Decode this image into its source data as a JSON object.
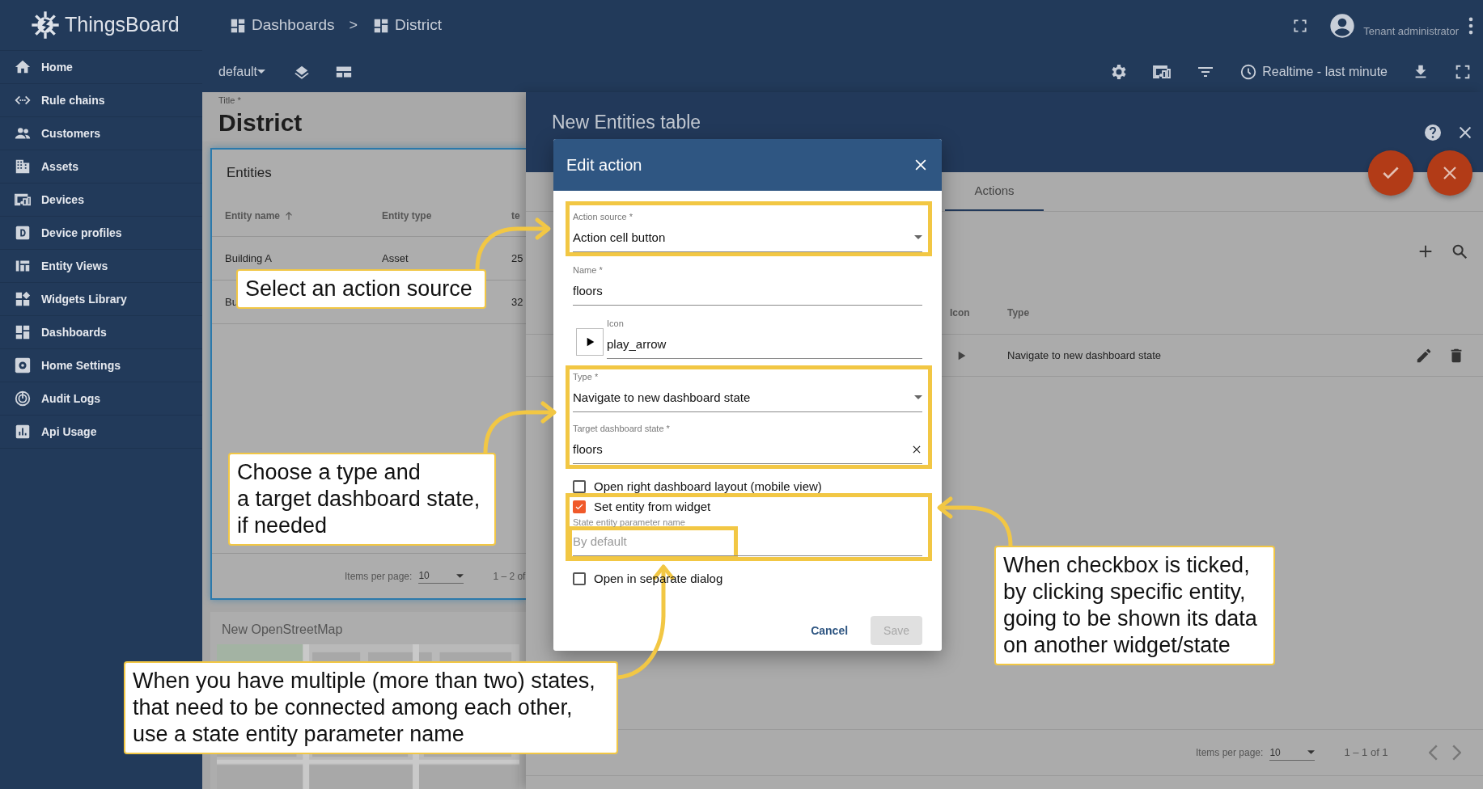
{
  "app": {
    "logo_text": "ThingsBoard"
  },
  "sidebar": {
    "items": [
      {
        "label": "Home"
      },
      {
        "label": "Rule chains"
      },
      {
        "label": "Customers"
      },
      {
        "label": "Assets"
      },
      {
        "label": "Devices"
      },
      {
        "label": "Device profiles"
      },
      {
        "label": "Entity Views"
      },
      {
        "label": "Widgets Library"
      },
      {
        "label": "Dashboards"
      },
      {
        "label": "Home Settings"
      },
      {
        "label": "Audit Logs"
      },
      {
        "label": "Api Usage"
      }
    ]
  },
  "breadcrumbs": {
    "items": [
      "Dashboards",
      "District"
    ],
    "separator": ">"
  },
  "user": {
    "role": "Tenant administrator"
  },
  "toolbar": {
    "state": "default",
    "timewindow": "Realtime - last minute"
  },
  "dashboard": {
    "title_label": "Title *",
    "title": "District",
    "entities_widget": {
      "title": "Entities",
      "columns": [
        "Entity name",
        "Entity type",
        "te"
      ],
      "rows": [
        {
          "cells": [
            "Building A",
            "Asset",
            "25"
          ]
        },
        {
          "cells": [
            "Bu",
            "",
            "32"
          ]
        }
      ],
      "paginator": {
        "label": "Items per page:",
        "page_size": "10",
        "range": "1 – 2 of"
      }
    },
    "map_widget": {
      "title": "New OpenStreetMap"
    }
  },
  "widget_editor": {
    "title": "New Entities table",
    "tabs": [
      {
        "label": "Actions",
        "selected": true
      }
    ],
    "table": {
      "columns": [
        "Icon",
        "Type"
      ],
      "rows": [
        {
          "type": "Navigate to new dashboard state"
        }
      ]
    },
    "paginator": {
      "label": "Items per page:",
      "page_size": "10",
      "range": "1 – 1 of 1"
    }
  },
  "dialog": {
    "title": "Edit action",
    "fields": [
      {
        "kind": "select",
        "label": "Action source *",
        "value": "Action cell button"
      },
      {
        "kind": "text",
        "label": "Name *",
        "value": "floors"
      },
      {
        "kind": "icon",
        "label": "Icon",
        "value": "play_arrow"
      },
      {
        "kind": "select",
        "label": "Type *",
        "value": "Navigate to new dashboard state"
      },
      {
        "kind": "clearable",
        "label": "Target dashboard state *",
        "value": "floors"
      }
    ],
    "options": [
      {
        "kind": "checkbox",
        "label": "Open right dashboard layout (mobile view)",
        "checked": false
      },
      {
        "kind": "checkbox",
        "label": "Set entity from widget",
        "checked": true
      },
      {
        "kind": "field",
        "label": "State entity parameter name",
        "placeholder": "By default"
      },
      {
        "kind": "checkbox",
        "label": "Open in separate dialog",
        "checked": false
      }
    ],
    "buttons": [
      {
        "label": "Cancel",
        "disabled": false
      },
      {
        "label": "Save",
        "disabled": true
      }
    ]
  },
  "callouts": [
    {
      "text": "Select an action source"
    },
    {
      "text": "Choose a type and\na target dashboard state,\nif needed"
    },
    {
      "text": "When you have multiple (more than two) states,\nthat need to be connected among each other,\nuse a state entity parameter name"
    },
    {
      "text": "When checkbox is ticked,\nby clicking specific entity,\ngoing to be shown its data\non another widget/state"
    }
  ]
}
